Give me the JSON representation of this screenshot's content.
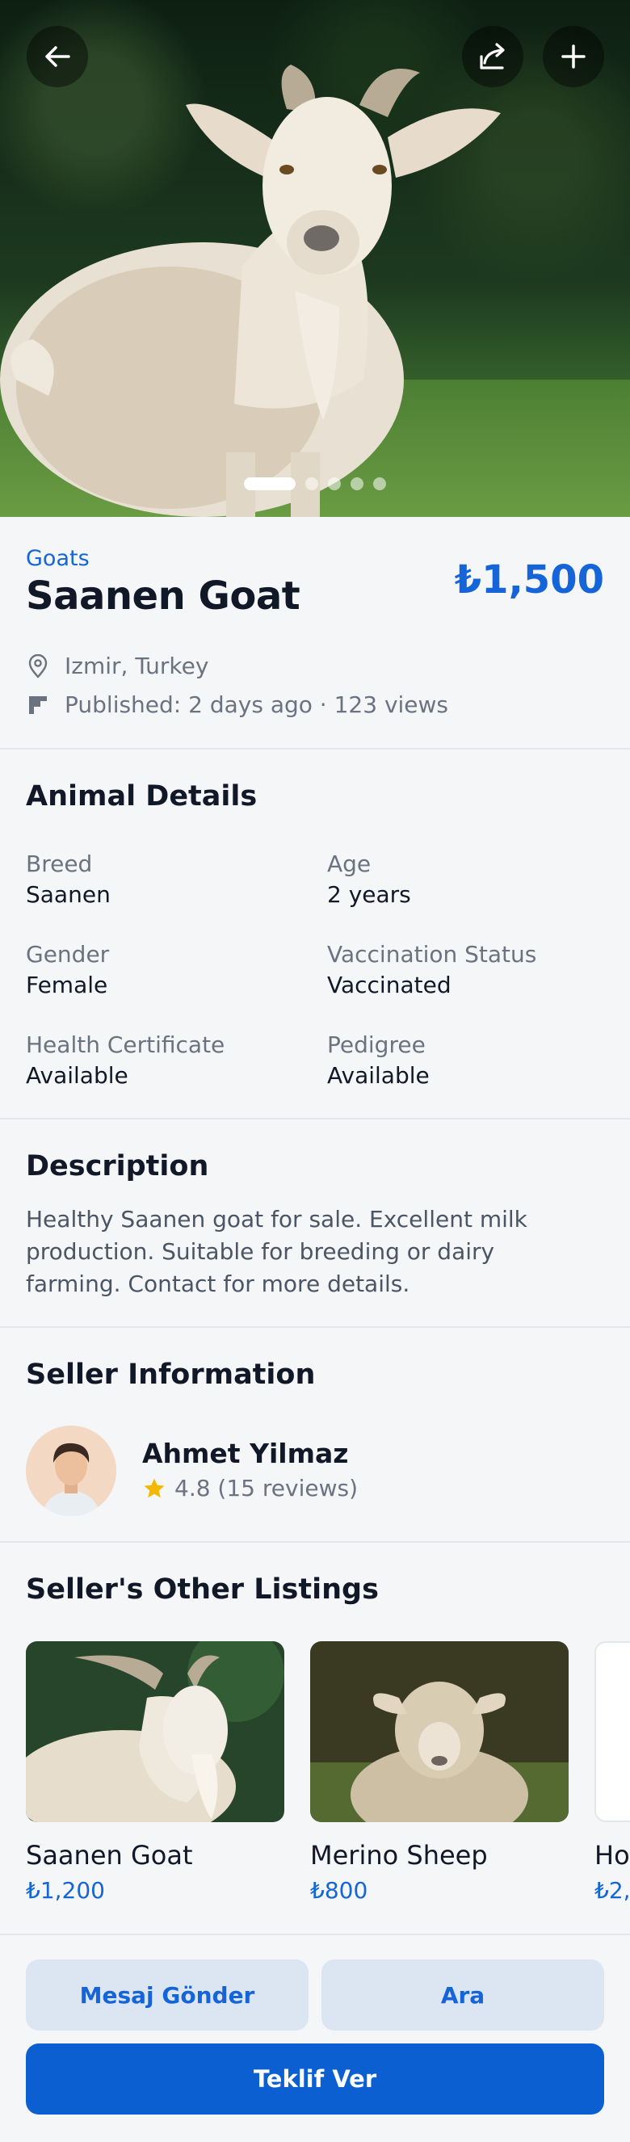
{
  "hero": {
    "back_icon": "arrow-left-icon",
    "share_icon": "share-icon",
    "add_icon": "plus-icon",
    "image": "goat-photo",
    "carousel": {
      "total": 5,
      "active": 0
    }
  },
  "listing": {
    "category": "Goats",
    "title": "Saanen Goat",
    "price": "₺1,500",
    "location": "Izmir, Turkey",
    "published": "Published: 2 days ago · 123 views"
  },
  "details": {
    "heading": "Animal Details",
    "items": [
      {
        "label": "Breed",
        "value": "Saanen"
      },
      {
        "label": "Age",
        "value": "2 years"
      },
      {
        "label": "Gender",
        "value": "Female"
      },
      {
        "label": "Vaccination Status",
        "value": "Vaccinated"
      },
      {
        "label": "Health Certificate",
        "value": "Available"
      },
      {
        "label": "Pedigree",
        "value": "Available"
      }
    ]
  },
  "description": {
    "heading": "Description",
    "text": "Healthy Saanen goat for sale. Excellent milk production. Suitable for breeding or dairy farming. Contact for more details."
  },
  "seller": {
    "heading": "Seller Information",
    "name": "Ahmet Yilmaz",
    "rating": "4.8 (15 reviews)"
  },
  "other_listings": {
    "heading": "Seller's Other Listings",
    "items": [
      {
        "name": "Saanen Goat",
        "price": "₺1,200"
      },
      {
        "name": "Merino Sheep",
        "price": "₺800"
      },
      {
        "name": "Ho",
        "price": "₺2,"
      }
    ]
  },
  "actions": {
    "message": "Mesaj Gönder",
    "call": "Ara",
    "offer": "Teklif Ver"
  },
  "colors": {
    "accent": "#1565d8",
    "primary_button": "#0b5fd1",
    "secondary_button": "#dce5f2",
    "star": "#f5b800"
  }
}
